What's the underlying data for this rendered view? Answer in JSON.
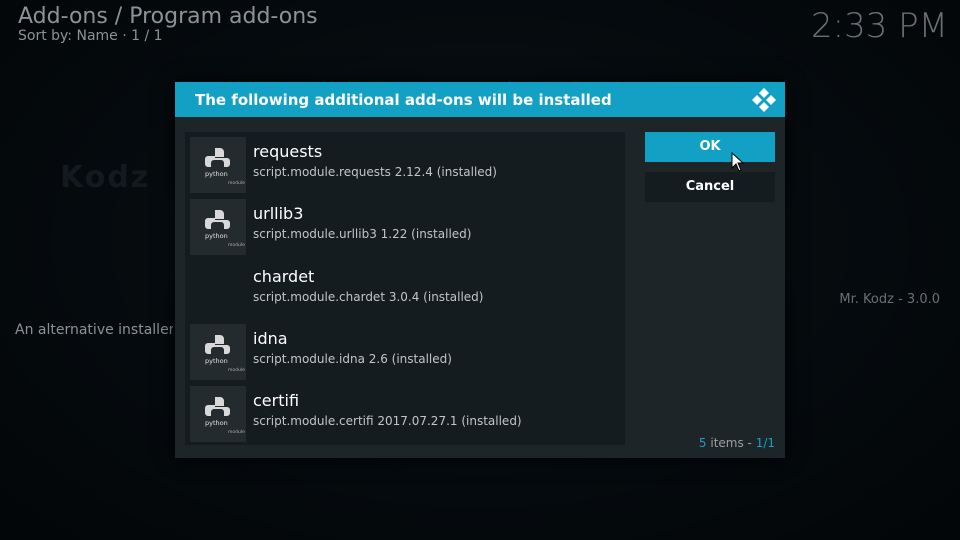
{
  "header": {
    "title": "Add-ons / Program add-ons",
    "sort": "Sort by: Name  ·  1 / 1",
    "clock": "2:33 PM"
  },
  "background": {
    "description": "An alternative installer for",
    "addon_name": "Mr. Kodz - 3.0.0",
    "wordmark": "Kodz"
  },
  "dialog": {
    "title": "The following additional add-ons will be installed",
    "logo": "kodi-logo",
    "ok_label": "OK",
    "cancel_label": "Cancel",
    "count_items": "5",
    "count_label": " items - ",
    "count_page": "1/1",
    "items": [
      {
        "name": "requests",
        "desc": "script.module.requests 2.12.4 (installed)",
        "icon": "python-module-icon"
      },
      {
        "name": "urllib3",
        "desc": "script.module.urllib3 1.22 (installed)",
        "icon": "python-module-icon"
      },
      {
        "name": "chardet",
        "desc": "script.module.chardet 3.0.4 (installed)",
        "icon": ""
      },
      {
        "name": "idna",
        "desc": "script.module.idna 2.6 (installed)",
        "icon": "python-module-icon"
      },
      {
        "name": "certifi",
        "desc": "script.module.certifi 2017.07.27.1 (installed)",
        "icon": "python-module-icon"
      }
    ],
    "thumb_text": "python",
    "thumb_sub": "module"
  },
  "colors": {
    "accent": "#12a0c4",
    "dialog_bg": "#1d2529",
    "list_bg": "#151c20"
  }
}
